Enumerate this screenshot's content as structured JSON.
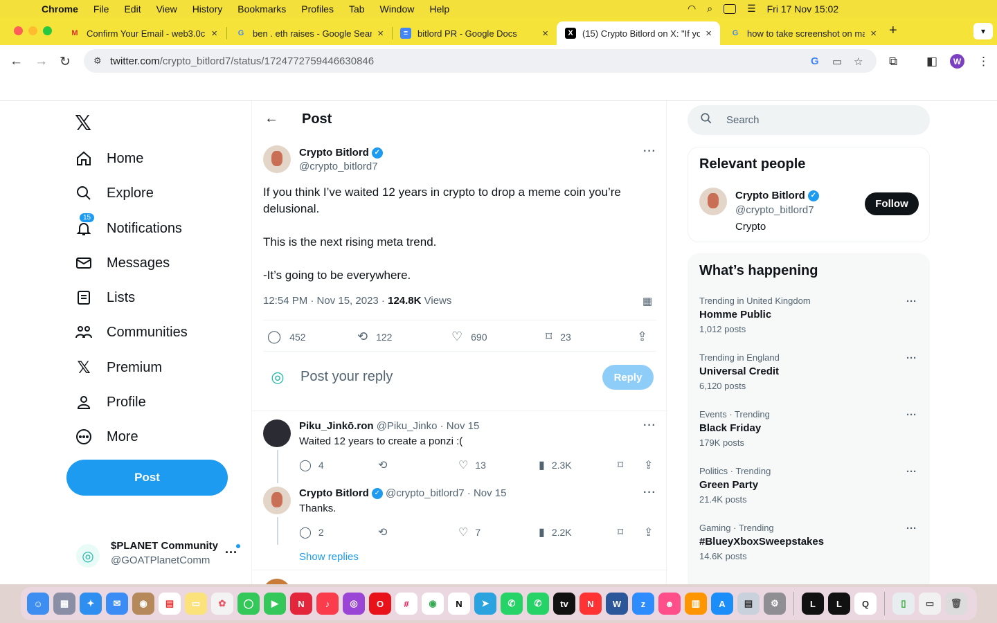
{
  "menubar": {
    "app": "Chrome",
    "items": [
      "File",
      "Edit",
      "View",
      "History",
      "Bookmarks",
      "Profiles",
      "Tab",
      "Window",
      "Help"
    ],
    "clock": "Fri 17 Nov  15:02"
  },
  "tabs": [
    {
      "title": "Confirm Your Email - web3.0c",
      "icon": "gmail-icon",
      "color": "#d93025",
      "glyph": "M"
    },
    {
      "title": "ben . eth raises - Google Sear",
      "icon": "google-icon",
      "color": "#4285f4",
      "glyph": "G"
    },
    {
      "title": "bitlord PR - Google Docs",
      "icon": "docs-icon",
      "color": "#4285f4",
      "glyph": "≡"
    },
    {
      "title": "(15) Crypto Bitlord on X: \"If yo",
      "icon": "x-icon",
      "color": "#000000",
      "glyph": "X"
    },
    {
      "title": "how to take screenshot on ma",
      "icon": "google-icon",
      "color": "#4285f4",
      "glyph": "G"
    }
  ],
  "address": {
    "domain": "twitter.com",
    "path": "/crypto_bitlord7/status/1724772759446630846"
  },
  "profile_initial": "W",
  "nav": {
    "items": [
      "Home",
      "Explore",
      "Notifications",
      "Messages",
      "Lists",
      "Communities",
      "Premium",
      "Profile",
      "More"
    ],
    "notif_badge": "15",
    "post_label": "Post"
  },
  "account": {
    "name": "$PLANET Community",
    "handle": "@GOATPlanetComm"
  },
  "post": {
    "header": "Post",
    "author": "Crypto Bitlord",
    "handle": "@crypto_bitlord7",
    "text": "If you think I’ve waited 12 years in crypto to drop a meme coin you’re delusional.\n\nThis is the next rising meta trend.\n\n-It’s going to be everywhere.",
    "time": "12:54 PM · Nov 15, 2023 · ",
    "views": "124.8K",
    "views_label": " Views",
    "replies": "452",
    "reposts": "122",
    "likes": "690",
    "bookmarks": "23"
  },
  "reply_box": {
    "placeholder": "Post your reply",
    "button": "Reply"
  },
  "replies": [
    {
      "name": "Piku_Jinkō.ron",
      "handle": "@Piku_Jinko · Nov 15",
      "text": "Waited 12 years to create a ponzi :(",
      "replies": "4",
      "likes": "13",
      "views": "2.3K"
    },
    {
      "name": "Crypto Bitlord",
      "handle": "@crypto_bitlord7 · Nov 15",
      "text": "Thanks.",
      "replies": "2",
      "likes": "7",
      "views": "2.2K"
    }
  ],
  "show_replies": "Show replies",
  "search_placeholder": "Search",
  "relevant": {
    "title": "Relevant people",
    "name": "Crypto Bitlord",
    "handle": "@crypto_bitlord7",
    "bio": "Crypto",
    "follow": "Follow"
  },
  "happening": {
    "title": "What’s happening",
    "trends": [
      {
        "context": "Trending in United Kingdom",
        "name": "Homme Public",
        "posts": "1,012 posts"
      },
      {
        "context": "Trending in England",
        "name": "Universal Credit",
        "posts": "6,120 posts"
      },
      {
        "context": "Events · Trending",
        "name": "Black Friday",
        "posts": "179K posts"
      },
      {
        "context": "Politics · Trending",
        "name": "Green Party",
        "posts": "21.4K posts"
      },
      {
        "context": "Gaming · Trending",
        "name": "#BlueyXboxSweepstakes",
        "posts": "14.6K posts"
      }
    ]
  },
  "colors": {
    "accent": "#1d9bf0",
    "chrome_frame": "#f6e33a",
    "text": "#0f1419",
    "muted": "#536471"
  }
}
